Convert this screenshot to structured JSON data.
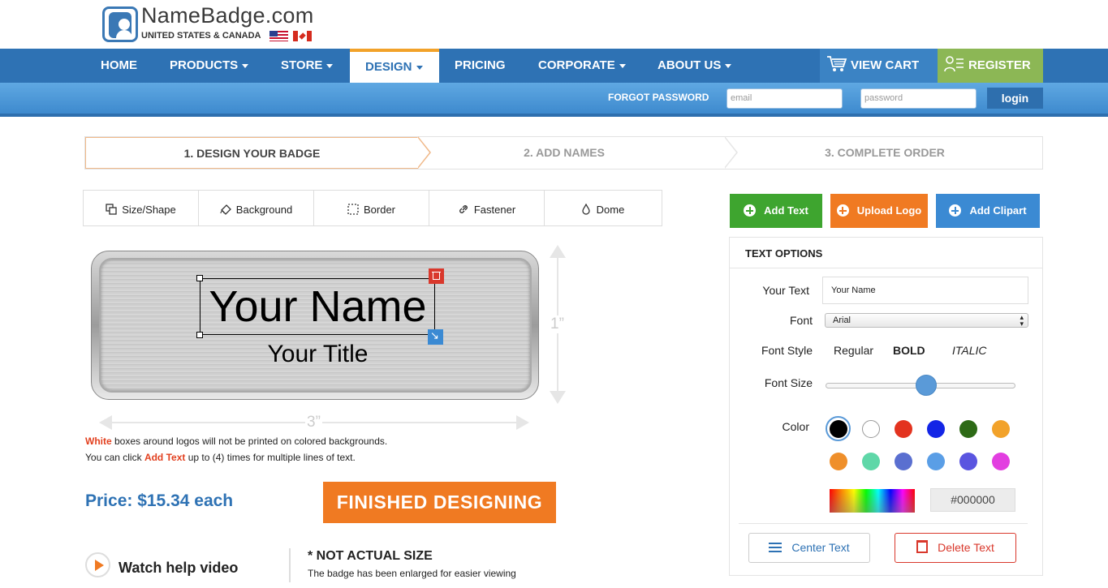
{
  "brand": {
    "name": "NameBadge.com",
    "subtitle": "UNITED STATES & CANADA"
  },
  "nav": {
    "items": [
      {
        "label": "HOME",
        "dropdown": false
      },
      {
        "label": "PRODUCTS",
        "dropdown": true
      },
      {
        "label": "STORE",
        "dropdown": true
      },
      {
        "label": "DESIGN",
        "dropdown": true,
        "active": true
      },
      {
        "label": "PRICING",
        "dropdown": false
      },
      {
        "label": "CORPORATE",
        "dropdown": true
      },
      {
        "label": "ABOUT US",
        "dropdown": true
      }
    ],
    "cart": "VIEW CART",
    "register": "REGISTER"
  },
  "login": {
    "forgot": "FORGOT PASSWORD",
    "email_placeholder": "email",
    "password_placeholder": "password",
    "button": "login"
  },
  "steps": [
    "1. DESIGN YOUR BADGE",
    "2. ADD NAMES",
    "3. COMPLETE ORDER"
  ],
  "design_tabs": [
    {
      "label": "Size/Shape",
      "icon": "size-shape-icon"
    },
    {
      "label": "Background",
      "icon": "paint-bucket-icon"
    },
    {
      "label": "Border",
      "icon": "border-icon"
    },
    {
      "label": "Fastener",
      "icon": "link-icon"
    },
    {
      "label": "Dome",
      "icon": "drop-icon"
    }
  ],
  "badge": {
    "name": "Your Name",
    "title": "Your Title",
    "height_label": "1”",
    "width_label": "3”"
  },
  "notes": {
    "line1_highlight": "White",
    "line1_rest": " boxes around logos will not be printed on colored backgrounds.",
    "line2_pre": "You can click ",
    "line2_highlight": "Add Text",
    "line2_rest": " up to (4) times for multiple lines of text."
  },
  "price": "Price: $15.34 each",
  "finished_button": "FINISHED DESIGNING",
  "help": {
    "watch": "Watch help video",
    "not_actual": "* NOT ACTUAL SIZE",
    "enlarged": "The badge has been enlarged for easier viewing"
  },
  "actions": {
    "add_text": "Add Text",
    "upload_logo": "Upload Logo",
    "add_clipart": "Add Clipart",
    "colors": {
      "add_text": "#3ea52f",
      "upload_logo": "#f07a22",
      "add_clipart": "#3b8ad3"
    }
  },
  "text_options": {
    "title": "TEXT OPTIONS",
    "your_text_label": "Your Text",
    "your_text_value": "Your Name",
    "font_label": "Font",
    "font_value": "Arial",
    "font_style_label": "Font Style",
    "styles": [
      "Regular",
      "BOLD",
      "ITALIC"
    ],
    "font_size_label": "Font Size",
    "font_size_fraction": 0.53,
    "color_label": "Color",
    "colors": [
      "#000000",
      "#ffffff",
      "#e3331f",
      "#1325e6",
      "#2d6a16",
      "#f2a22a",
      "#ef8f2a",
      "#5fd7a8",
      "#5a6fd0",
      "#5a9ee6",
      "#5a55e0",
      "#e23ee0"
    ],
    "selected_color": "#000000",
    "hex_value": "#000000",
    "center_button": "Center Text",
    "delete_button": "Delete Text"
  }
}
